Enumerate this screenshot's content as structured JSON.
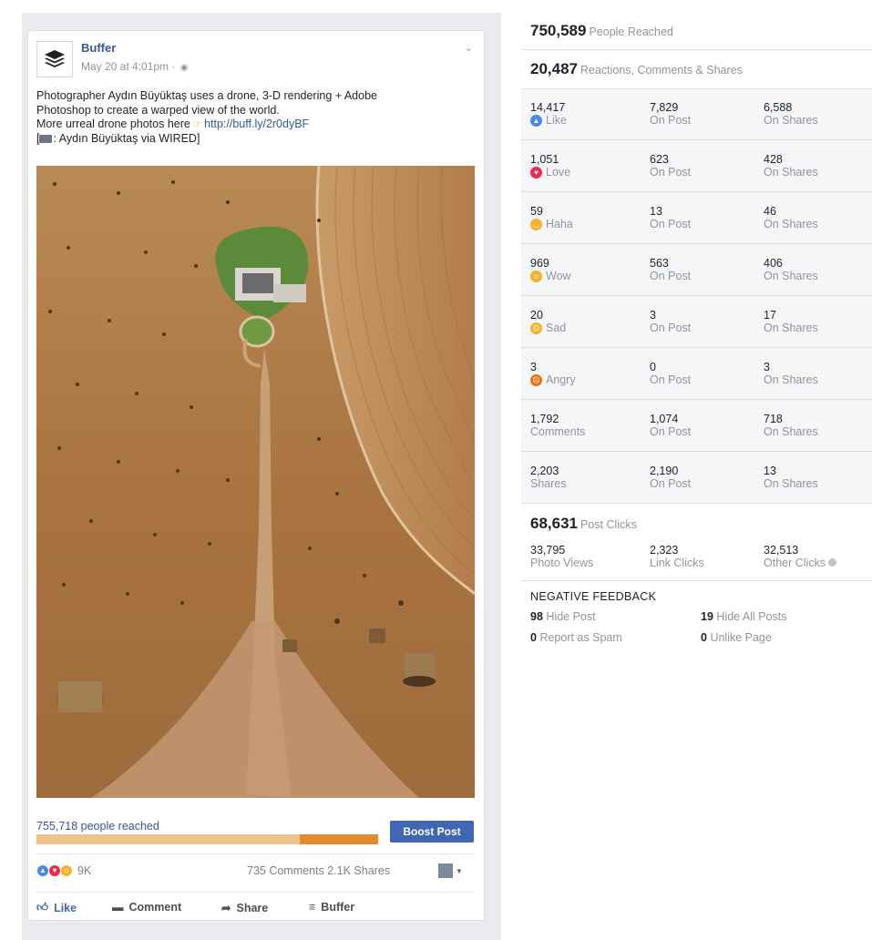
{
  "post": {
    "page_name": "Buffer",
    "timestamp": "May 20 at 4:01pm · ",
    "text_line1": "Photographer Aydın Büyüktaş uses a drone, 3-D rendering + Adobe",
    "text_line2": "Photoshop to create a warped view of the world.",
    "text_line3_prefix": "More urreal drone photos here",
    "link": "http://buff.ly/2r0dyBF",
    "credit_prefix": "[",
    "credit_text": ": Aydın Büyüktaş via WIRED]",
    "people_reached": "755,718 people reached",
    "reach_fraction": 0.23,
    "boost_label": "Boost Post",
    "reaction_count": "9K",
    "comments_shares": "735 Comments  2.1K Shares",
    "actions": {
      "like": "Like",
      "comment": "Comment",
      "share": "Share",
      "buffer": "Buffer"
    },
    "colors": {
      "accent": "#4267b2",
      "link": "#365899",
      "reach_light": "#f2c28b",
      "reach_dark": "#e38a2d"
    }
  },
  "insights": {
    "people_reached": {
      "value": "750,589",
      "label": "People Reached"
    },
    "engagement": {
      "value": "20,487",
      "label": "Reactions, Comments & Shares"
    },
    "rows": [
      {
        "total": "14,417",
        "label": "Like",
        "icon": "like-icon",
        "on_post": "7,829",
        "on_shares": "6,588",
        "post_label": "On Post",
        "shares_label": "On Shares"
      },
      {
        "total": "1,051",
        "label": "Love",
        "icon": "love-icon",
        "on_post": "623",
        "on_shares": "428",
        "post_label": "On Post",
        "shares_label": "On Shares"
      },
      {
        "total": "59",
        "label": "Haha",
        "icon": "haha-icon",
        "on_post": "13",
        "on_shares": "46",
        "post_label": "On Post",
        "shares_label": "On Shares"
      },
      {
        "total": "969",
        "label": "Wow",
        "icon": "wow-icon",
        "on_post": "563",
        "on_shares": "406",
        "post_label": "On Post",
        "shares_label": "On Shares"
      },
      {
        "total": "20",
        "label": "Sad",
        "icon": "sad-icon",
        "on_post": "3",
        "on_shares": "17",
        "post_label": "On Post",
        "shares_label": "On Shares"
      },
      {
        "total": "3",
        "label": "Angry",
        "icon": "angry-icon",
        "on_post": "0",
        "on_shares": "3",
        "post_label": "On Post",
        "shares_label": "On Shares"
      },
      {
        "total": "1,792",
        "label": "Comments",
        "icon": "",
        "on_post": "1,074",
        "on_shares": "718",
        "post_label": "On Post",
        "shares_label": "On Shares"
      },
      {
        "total": "2,203",
        "label": "Shares",
        "icon": "",
        "on_post": "2,190",
        "on_shares": "13",
        "post_label": "On Post",
        "shares_label": "On Shares"
      }
    ],
    "post_clicks": {
      "value": "68,631",
      "label": "Post Clicks"
    },
    "clicks": [
      {
        "value": "33,795",
        "label": "Photo Views"
      },
      {
        "value": "2,323",
        "label": "Link Clicks"
      },
      {
        "value": "32,513",
        "label": "Other Clicks"
      }
    ],
    "negative_title": "NEGATIVE FEEDBACK",
    "negative": [
      {
        "value": "98",
        "label": "Hide Post"
      },
      {
        "value": "19",
        "label": "Hide All Posts"
      },
      {
        "value": "0",
        "label": "Report as Spam"
      },
      {
        "value": "0",
        "label": "Unlike Page"
      }
    ]
  }
}
